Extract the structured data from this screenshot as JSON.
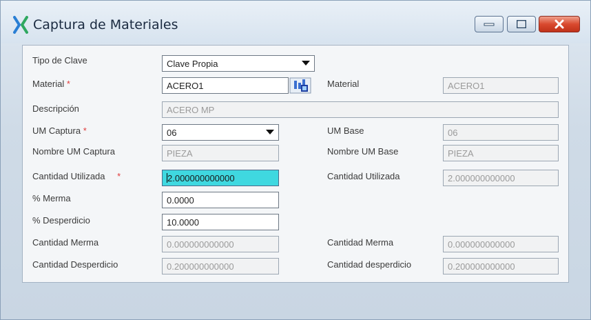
{
  "window": {
    "title": "Captura de Materiales",
    "colors": {
      "accent": "#2a7fd4",
      "close": "#d94a2f",
      "highlight": "#3fd8e0",
      "required": "#e03a3a"
    }
  },
  "form": {
    "tipo_clave": {
      "label": "Tipo de Clave",
      "value": "Clave Propia"
    },
    "material": {
      "label": "Material",
      "value": "ACERO1"
    },
    "material_right": {
      "label": "Material",
      "value": "ACERO1"
    },
    "descripcion": {
      "label": "Descripción",
      "value": "ACERO MP"
    },
    "um_captura": {
      "label": "UM Captura",
      "value": "06"
    },
    "um_base": {
      "label": "UM Base",
      "value": "06"
    },
    "nombre_um_captura": {
      "label": "Nombre UM Captura",
      "value": "PIEZA"
    },
    "nombre_um_base": {
      "label": "Nombre UM Base",
      "value": "PIEZA"
    },
    "cantidad_utilizada": {
      "label": "Cantidad Utilizada",
      "value": "2.000000000000"
    },
    "cantidad_utilizada_right": {
      "label": "Cantidad Utilizada",
      "value": "2.000000000000"
    },
    "merma": {
      "label": "% Merma",
      "value": "0.0000"
    },
    "desperdicio": {
      "label": "% Desperdicio",
      "value": "10.0000"
    },
    "cantidad_merma": {
      "label": "Cantidad Merma",
      "value": "0.000000000000"
    },
    "cantidad_merma_right": {
      "label": "Cantidad Merma",
      "value": "0.000000000000"
    },
    "cantidad_desperdicio": {
      "label": "Cantidad Desperdicio",
      "value": "0.200000000000"
    },
    "cantidad_desperdicio_right": {
      "label": "Cantidad desperdicio",
      "value": "0.200000000000"
    },
    "required_mark": "*"
  }
}
